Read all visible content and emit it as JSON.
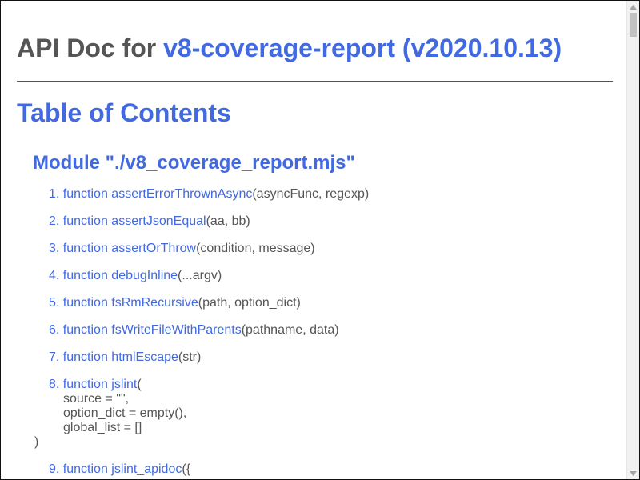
{
  "header": {
    "title_prefix": "API Doc for",
    "title_link": "v8-coverage-report (v2020.10.13)"
  },
  "toc": {
    "heading": "Table of Contents",
    "module_heading": "Module \"./v8_coverage_report.mjs\"",
    "items": [
      {
        "num": "1.",
        "kw": "function",
        "name": "assertErrorThrownAsync",
        "params": "(asyncFunc, regexp)"
      },
      {
        "num": "2.",
        "kw": "function",
        "name": "assertJsonEqual",
        "params": "(aa, bb)"
      },
      {
        "num": "3.",
        "kw": "function",
        "name": "assertOrThrow",
        "params": "(condition, message)"
      },
      {
        "num": "4.",
        "kw": "function",
        "name": "debugInline",
        "params": "(...argv)"
      },
      {
        "num": "5.",
        "kw": "function",
        "name": "fsRmRecursive",
        "params": "(path, option_dict)"
      },
      {
        "num": "6.",
        "kw": "function",
        "name": "fsWriteFileWithParents",
        "params": "(pathname, data)"
      },
      {
        "num": "7.",
        "kw": "function",
        "name": "htmlEscape",
        "params": "(str)"
      },
      {
        "num": "8.",
        "kw": "function",
        "name": "jslint",
        "params_open": "(",
        "params_lines": [
          "source = \"\",",
          "option_dict = empty(),",
          "global_list = []"
        ],
        "params_close": ")"
      },
      {
        "num": "9.",
        "kw": "function",
        "name": "jslint_apidoc",
        "params": "({"
      }
    ]
  },
  "scrollbar": {
    "up_icon": "triangle-up",
    "down_icon": "triangle-down"
  }
}
